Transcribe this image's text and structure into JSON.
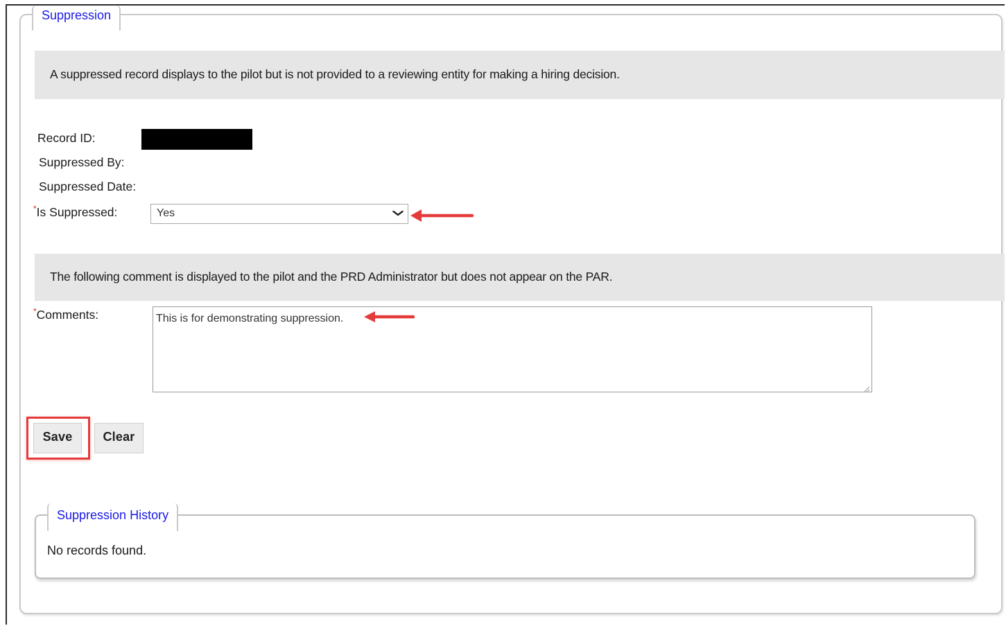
{
  "suppression_section": {
    "legend": "Suppression",
    "info_text": "A suppressed record displays to the pilot but is not provided to a reviewing entity for making a hiring decision."
  },
  "record": {
    "record_id_label": "Record ID:",
    "suppressed_by_label": "Suppressed By:",
    "suppressed_date_label": "Suppressed Date:",
    "required_marker": "*",
    "is_suppressed_label": "Is Suppressed:",
    "is_suppressed_value": "Yes"
  },
  "comment_section": {
    "info_text": "The following comment is displayed to the pilot and the PRD Administrator but does not appear on the PAR.",
    "comments_label": "Comments:",
    "comments_value": "This is for demonstrating suppression."
  },
  "buttons": {
    "save_label": "Save",
    "clear_label": "Clear"
  },
  "history_section": {
    "legend": "Suppression History",
    "empty_text": "No records found."
  },
  "colors": {
    "legend_text": "#1a1ae6",
    "info_band": "#e6e6e6",
    "required_marker": "#e02020",
    "annotation_arrow": "#e53a3a"
  },
  "icons": {
    "select_chevron": "chevron-down-icon",
    "annotation": "red-arrow-left-icon"
  }
}
